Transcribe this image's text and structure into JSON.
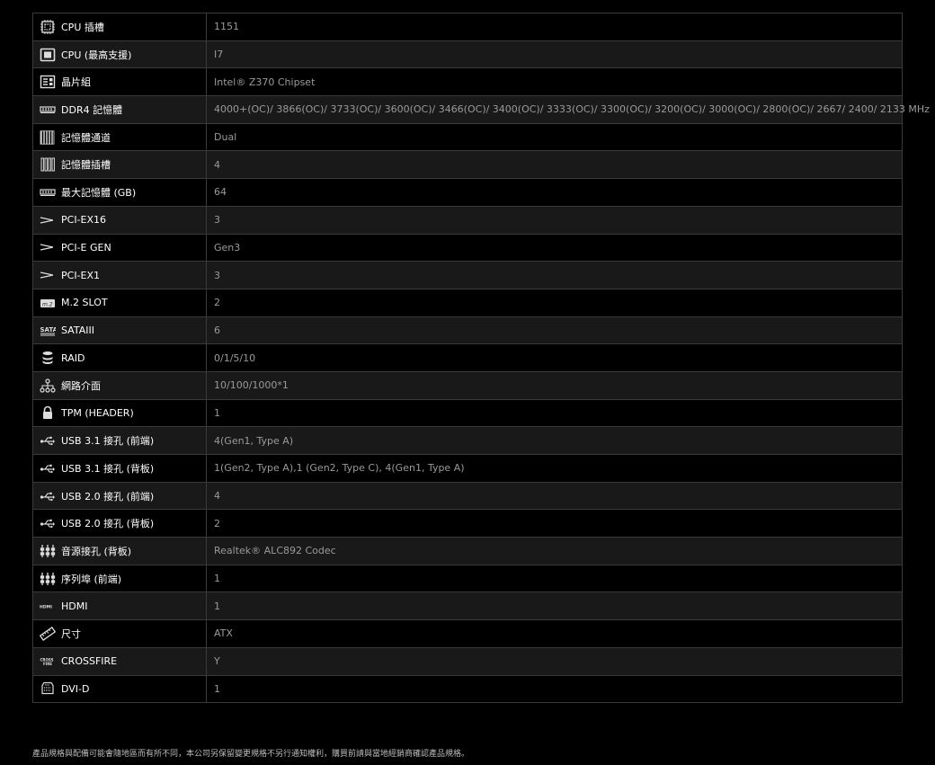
{
  "specs": [
    {
      "icon": "cpu-socket-icon",
      "label": "CPU 插槽",
      "value": "1151"
    },
    {
      "icon": "cpu-icon",
      "label": "CPU (最高支援)",
      "value": "I7"
    },
    {
      "icon": "chipset-icon",
      "label": "晶片組",
      "value": "Intel® Z370 Chipset"
    },
    {
      "icon": "memory-icon",
      "label": "DDR4 記憶體",
      "value": "4000+(OC)/ 3866(OC)/ 3733(OC)/ 3600(OC)/ 3466(OC)/ 3400(OC)/ 3333(OC)/ 3300(OC)/ 3200(OC)/ 3000(OC)/ 2800(OC)/ 2667/ 2400/ 2133 MHz"
    },
    {
      "icon": "memory-channel-icon",
      "label": "記憶體通道",
      "value": "Dual"
    },
    {
      "icon": "memory-slot-icon",
      "label": "記憶體插槽",
      "value": "4"
    },
    {
      "icon": "memory-icon",
      "label": "最大記憶體 (GB)",
      "value": "64"
    },
    {
      "icon": "pcie-icon",
      "label": "PCI-EX16",
      "value": "3"
    },
    {
      "icon": "pcie-icon",
      "label": "PCI-E GEN",
      "value": "Gen3"
    },
    {
      "icon": "pcie-icon",
      "label": "PCI-EX1",
      "value": "3"
    },
    {
      "icon": "m2-icon",
      "label": "M.2 SLOT",
      "value": "2"
    },
    {
      "icon": "sata-icon",
      "label": "SATAIII",
      "value": "6"
    },
    {
      "icon": "raid-icon",
      "label": "RAID",
      "value": "0/1/5/10"
    },
    {
      "icon": "network-icon",
      "label": "網路介面",
      "value": "10/100/1000*1"
    },
    {
      "icon": "lock-icon",
      "label": "TPM (HEADER)",
      "value": "1"
    },
    {
      "icon": "usb-icon",
      "label": "USB 3.1 接孔 (前端)",
      "value": "4(Gen1, Type A)"
    },
    {
      "icon": "usb-icon",
      "label": "USB 3.1 接孔 (背板)",
      "value": "1(Gen2, Type A),1 (Gen2, Type C), 4(Gen1, Type A)"
    },
    {
      "icon": "usb-icon",
      "label": "USB 2.0 接孔 (前端)",
      "value": "4"
    },
    {
      "icon": "usb-icon",
      "label": "USB 2.0 接孔 (背板)",
      "value": "2"
    },
    {
      "icon": "audio-jack-icon",
      "label": "音源接孔 (背板)",
      "value": "Realtek® ALC892 Codec"
    },
    {
      "icon": "audio-jack-icon",
      "label": "序列埠 (前端)",
      "value": "1"
    },
    {
      "icon": "hdmi-icon",
      "label": "HDMI",
      "value": "1"
    },
    {
      "icon": "ruler-icon",
      "label": "尺寸",
      "value": "ATX"
    },
    {
      "icon": "crossfire-icon",
      "label": "CROSSFIRE",
      "value": "Y"
    },
    {
      "icon": "dvi-icon",
      "label": "DVI-D",
      "value": "1"
    }
  ],
  "footnote": "產品規格與配備可能會隨地區而有所不同，本公司另保留變更規格不另行通知權利，購買前請與當地經銷商確認產品規格。",
  "colors": {
    "background": "#000000",
    "row_alt": "#191919",
    "border": "#3a3a3a",
    "label_text": "#ffffff",
    "value_text": "#9a9a9a"
  }
}
